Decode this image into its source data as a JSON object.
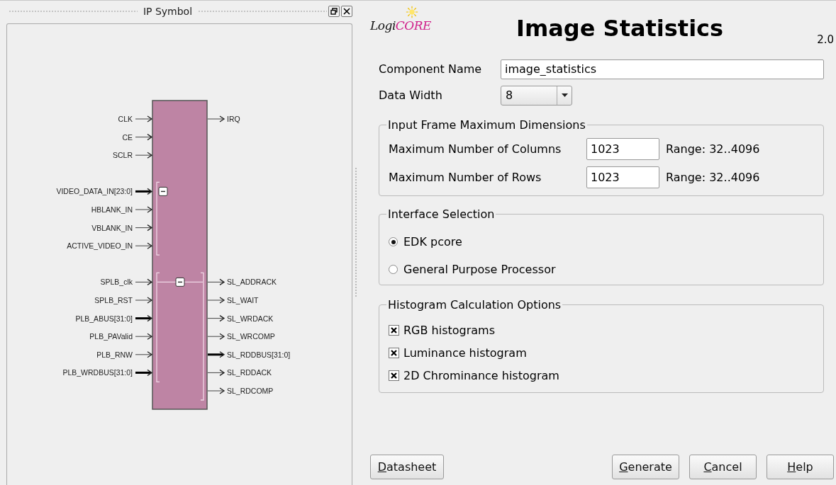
{
  "symbol_panel": {
    "title": "IP Symbol"
  },
  "symbol": {
    "loose": {
      "left": [
        {
          "name": "CLK",
          "bus": false
        },
        {
          "name": "CE",
          "bus": false
        },
        {
          "name": "SCLR",
          "bus": false
        }
      ],
      "right": [
        {
          "name": "IRQ",
          "bus": false
        }
      ]
    },
    "interfaces": [
      {
        "expanded": true,
        "left": [
          {
            "name": "VIDEO_DATA_IN[23:0]",
            "bus": true
          },
          {
            "name": "HBLANK_IN",
            "bus": false
          },
          {
            "name": "VBLANK_IN",
            "bus": false
          },
          {
            "name": "ACTIVE_VIDEO_IN",
            "bus": false
          }
        ]
      },
      {
        "expanded": true,
        "left": [
          {
            "name": "SPLB_clk",
            "bus": false
          },
          {
            "name": "SPLB_RST",
            "bus": false
          },
          {
            "name": "PLB_ABUS[31:0]",
            "bus": true
          },
          {
            "name": "PLB_PAValid",
            "bus": false
          },
          {
            "name": "PLB_RNW",
            "bus": false
          },
          {
            "name": "PLB_WRDBUS[31:0]",
            "bus": true
          }
        ],
        "right": [
          {
            "name": "SL_ADDRACK",
            "bus": false
          },
          {
            "name": "SL_WAIT",
            "bus": false
          },
          {
            "name": "SL_WRDACK",
            "bus": false
          },
          {
            "name": "SL_WRCOMP",
            "bus": false
          },
          {
            "name": "SL_RDDBUS[31:0]",
            "bus": true
          },
          {
            "name": "SL_RDDACK",
            "bus": false
          },
          {
            "name": "SL_RDCOMP",
            "bus": false
          }
        ]
      }
    ]
  },
  "logo": {
    "prefix": "Logi",
    "suffix": "CORE"
  },
  "title": "Image Statistics",
  "version": "2.0",
  "component_name": {
    "label": "Component Name",
    "value": "image_statistics"
  },
  "data_width": {
    "label": "Data Width",
    "value": "8"
  },
  "frame_group": {
    "legend": "Input Frame Maximum Dimensions",
    "rows": [
      {
        "label": "Maximum Number of Columns",
        "value": "1023",
        "range": "Range: 32..4096"
      },
      {
        "label": "Maximum Number of Rows",
        "value": "1023",
        "range": "Range: 32..4096"
      }
    ]
  },
  "interface_group": {
    "legend": "Interface Selection",
    "options": [
      {
        "label": "EDK pcore",
        "selected": true
      },
      {
        "label": "General Purpose Processor",
        "selected": false
      }
    ]
  },
  "histogram_group": {
    "legend": "Histogram Calculation Options",
    "options": [
      {
        "label": "RGB histograms",
        "checked": true
      },
      {
        "label": "Luminance histogram",
        "checked": true
      },
      {
        "label": "2D Chrominance histogram",
        "checked": true
      }
    ]
  },
  "buttons_left": [
    {
      "label": "Datasheet",
      "mnemonic_first": true
    }
  ],
  "buttons_right": [
    {
      "label": "Generate",
      "mnemonic_first": true
    },
    {
      "label": "Cancel",
      "mnemonic_first": true
    },
    {
      "label": "Help",
      "mnemonic_first": true
    }
  ]
}
